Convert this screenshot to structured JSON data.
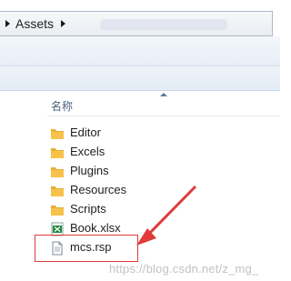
{
  "breadcrumb": {
    "folder": "Assets"
  },
  "columns": {
    "name": "名称"
  },
  "files": [
    {
      "name": "Editor",
      "type": "folder"
    },
    {
      "name": "Excels",
      "type": "folder"
    },
    {
      "name": "Plugins",
      "type": "folder"
    },
    {
      "name": "Resources",
      "type": "folder"
    },
    {
      "name": "Scripts",
      "type": "folder"
    },
    {
      "name": "Book.xlsx",
      "type": "excel-file"
    },
    {
      "name": "mcs.rsp",
      "type": "text-file"
    }
  ],
  "watermark": "https://blog.csdn.net/z_mg_",
  "colors": {
    "highlight": "#e03a3a",
    "folder": "#f6c24a",
    "excel": "#1e8a3c"
  }
}
